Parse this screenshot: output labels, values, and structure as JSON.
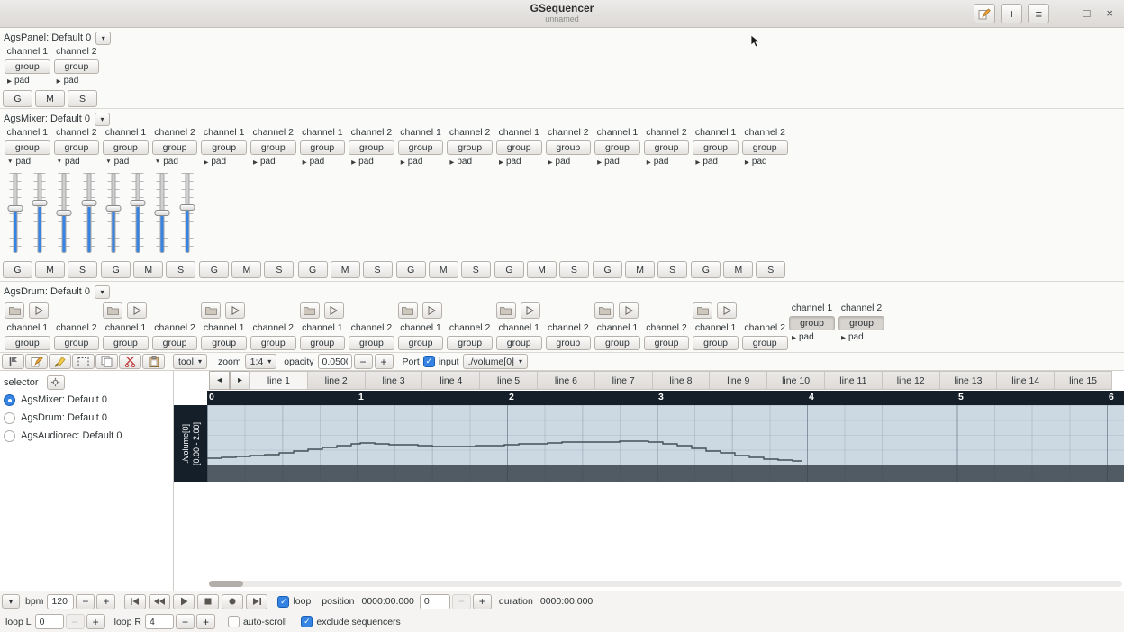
{
  "icons": {
    "dropdown": "▾",
    "add": "+",
    "menu": "≡",
    "minimize": "–",
    "maximize": "□",
    "close": "×",
    "tab_prev": "◂",
    "tab_next": "▸",
    "minus": "−",
    "plus": "+",
    "check": "✓"
  },
  "titlebar": {
    "title": "GSequencer",
    "subtitle": "unnamed"
  },
  "panel": {
    "name": "AgsPanel: Default 0",
    "channels": [
      {
        "channel": "channel 1",
        "group": "group",
        "pad": "pad",
        "arrow": "▶"
      },
      {
        "channel": "channel 2",
        "group": "group",
        "pad": "pad",
        "arrow": "▶"
      }
    ],
    "gms": {
      "g": "G",
      "m": "M",
      "s": "S"
    }
  },
  "mixer": {
    "name": "AgsMixer: Default 0",
    "channels": [
      {
        "channel": "channel 1",
        "group": "group",
        "pad": "pad",
        "arrow": "▼"
      },
      {
        "channel": "channel 2",
        "group": "group",
        "pad": "pad",
        "arrow": "▼"
      },
      {
        "channel": "channel 1",
        "group": "group",
        "pad": "pad",
        "arrow": "▼"
      },
      {
        "channel": "channel 2",
        "group": "group",
        "pad": "pad",
        "arrow": "▼"
      },
      {
        "channel": "channel 1",
        "group": "group",
        "pad": "pad",
        "arrow": "▶"
      },
      {
        "channel": "channel 2",
        "group": "group",
        "pad": "pad",
        "arrow": "▶"
      },
      {
        "channel": "channel 1",
        "group": "group",
        "pad": "pad",
        "arrow": "▶"
      },
      {
        "channel": "channel 2",
        "group": "group",
        "pad": "pad",
        "arrow": "▶"
      },
      {
        "channel": "channel 1",
        "group": "group",
        "pad": "pad",
        "arrow": "▶"
      },
      {
        "channel": "channel 2",
        "group": "group",
        "pad": "pad",
        "arrow": "▶"
      },
      {
        "channel": "channel 1",
        "group": "group",
        "pad": "pad",
        "arrow": "▶"
      },
      {
        "channel": "channel 2",
        "group": "group",
        "pad": "pad",
        "arrow": "▶"
      },
      {
        "channel": "channel 1",
        "group": "group",
        "pad": "pad",
        "arrow": "▶"
      },
      {
        "channel": "channel 2",
        "group": "group",
        "pad": "pad",
        "arrow": "▶"
      },
      {
        "channel": "channel 1",
        "group": "group",
        "pad": "pad",
        "arrow": "▶"
      },
      {
        "channel": "channel 2",
        "group": "group",
        "pad": "pad",
        "arrow": "▶"
      }
    ],
    "sliders": [
      {
        "pct": 52
      },
      {
        "pct": 58
      },
      {
        "pct": 47
      },
      {
        "pct": 58
      },
      {
        "pct": 52
      },
      {
        "pct": 58
      },
      {
        "pct": 47
      },
      {
        "pct": 53
      }
    ],
    "gms": [
      {
        "g": "G",
        "m": "M",
        "s": "S"
      },
      {
        "g": "G",
        "m": "M",
        "s": "S"
      },
      {
        "g": "G",
        "m": "M",
        "s": "S"
      },
      {
        "g": "G",
        "m": "M",
        "s": "S"
      },
      {
        "g": "G",
        "m": "M",
        "s": "S"
      },
      {
        "g": "G",
        "m": "M",
        "s": "S"
      },
      {
        "g": "G",
        "m": "M",
        "s": "S"
      },
      {
        "g": "G",
        "m": "M",
        "s": "S"
      }
    ]
  },
  "drum": {
    "name": "AgsDrum: Default 0",
    "pairs": [
      {},
      {},
      {},
      {},
      {},
      {},
      {},
      {}
    ],
    "channels": [
      {
        "channel": "channel 1",
        "group": "group"
      },
      {
        "channel": "channel 2",
        "group": "group"
      },
      {
        "channel": "channel 1",
        "group": "group"
      },
      {
        "channel": "channel 2",
        "group": "group"
      },
      {
        "channel": "channel 1",
        "group": "group"
      },
      {
        "channel": "channel 2",
        "group": "group"
      },
      {
        "channel": "channel 1",
        "group": "group"
      },
      {
        "channel": "channel 2",
        "group": "group"
      },
      {
        "channel": "channel 1",
        "group": "group"
      },
      {
        "channel": "channel 2",
        "group": "group"
      },
      {
        "channel": "channel 1",
        "group": "group"
      },
      {
        "channel": "channel 2",
        "group": "group"
      },
      {
        "channel": "channel 1",
        "group": "group"
      },
      {
        "channel": "channel 2",
        "group": "group"
      },
      {
        "channel": "channel 1",
        "group": "group"
      },
      {
        "channel": "channel 2",
        "group": "group"
      }
    ],
    "inputs": [
      {
        "channel": "channel 1",
        "group": "group",
        "pad": "pad",
        "arrow": "▶"
      },
      {
        "channel": "channel 2",
        "group": "group",
        "pad": "pad",
        "arrow": "▶"
      }
    ]
  },
  "toolbar": {
    "tool": "tool",
    "zoom_label": "zoom",
    "zoom_value": "1:4",
    "opacity_label": "opacity",
    "opacity_value": "0.0500",
    "port_label": "Port",
    "input_label": "input",
    "port_value": "./volume[0]"
  },
  "selector": {
    "label": "selector",
    "items": [
      {
        "label": "AgsMixer: Default 0",
        "selected": true
      },
      {
        "label": "AgsDrum: Default 0",
        "selected": false
      },
      {
        "label": "AgsAudiorec: Default 0",
        "selected": false
      }
    ]
  },
  "editor": {
    "tabs": [
      "line 1",
      "line 2",
      "line 3",
      "line 4",
      "line 5",
      "line 6",
      "line 7",
      "line 8",
      "line 9",
      "line 10",
      "line 11",
      "line 12",
      "line 13",
      "line 14",
      "line 15"
    ],
    "ruler": [
      "0",
      "1",
      "2",
      "3",
      "4",
      "5",
      "6"
    ],
    "control_name": "./volume[0]",
    "control_range": "[0.00 - 2.00]",
    "curve": {
      "points": [
        [
          0,
          59
        ],
        [
          16,
          58
        ],
        [
          32,
          57
        ],
        [
          48,
          56
        ],
        [
          64,
          55
        ],
        [
          80,
          53
        ],
        [
          96,
          51
        ],
        [
          112,
          49
        ],
        [
          128,
          47
        ],
        [
          144,
          45
        ],
        [
          160,
          43
        ],
        [
          170,
          42
        ],
        [
          186,
          43
        ],
        [
          202,
          44
        ],
        [
          218,
          44
        ],
        [
          234,
          45
        ],
        [
          250,
          46
        ],
        [
          266,
          46
        ],
        [
          282,
          46
        ],
        [
          298,
          45
        ],
        [
          314,
          45
        ],
        [
          330,
          44
        ],
        [
          346,
          43
        ],
        [
          362,
          43
        ],
        [
          378,
          42
        ],
        [
          394,
          41
        ],
        [
          410,
          41
        ],
        [
          426,
          41
        ],
        [
          442,
          41
        ],
        [
          458,
          40
        ],
        [
          474,
          40
        ],
        [
          490,
          41
        ],
        [
          506,
          43
        ],
        [
          522,
          45
        ],
        [
          538,
          48
        ],
        [
          554,
          51
        ],
        [
          570,
          53
        ],
        [
          586,
          56
        ],
        [
          602,
          58
        ],
        [
          618,
          60
        ],
        [
          634,
          61
        ],
        [
          650,
          62
        ],
        [
          660,
          62
        ]
      ]
    }
  },
  "transport": {
    "bpm_label": "bpm",
    "bpm_value": "120",
    "loop_label": "loop",
    "loop_checked": true,
    "position_label": "position",
    "position_time": "0000:00.000",
    "position_value": "0",
    "duration_label": "duration",
    "duration_time": "0000:00.000"
  },
  "loopbar": {
    "loop_l_label": "loop L",
    "loop_l_value": "0",
    "loop_r_label": "loop R",
    "loop_r_value": "4",
    "autoscroll_label": "auto-scroll",
    "autoscroll_checked": false,
    "exclude_label": "exclude sequencers",
    "exclude_checked": true
  }
}
